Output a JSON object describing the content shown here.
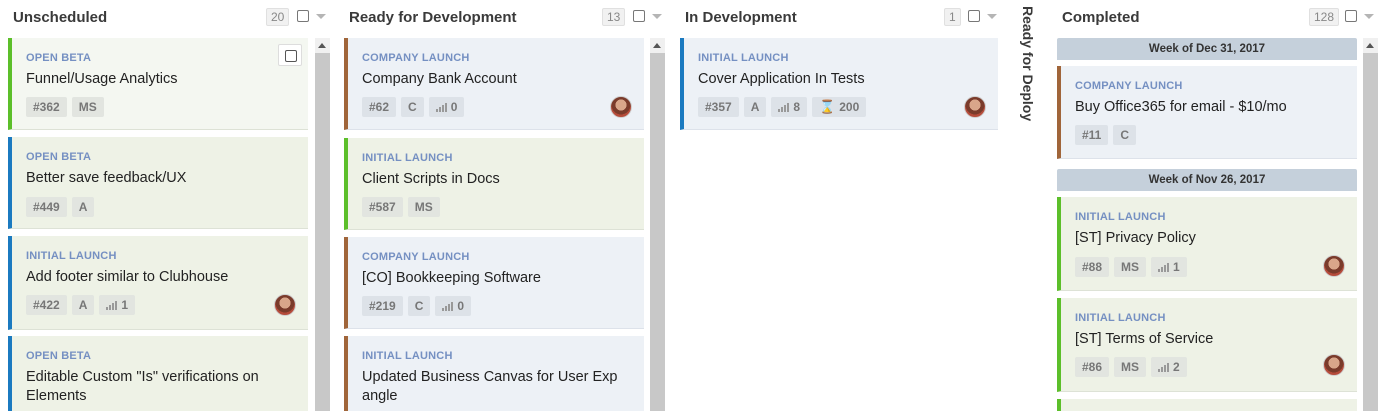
{
  "columns": [
    {
      "title": "Unscheduled",
      "count": "20",
      "cards": [
        {
          "epic": "OPEN BETA",
          "title": "Funnel/Usage Analytics",
          "badges": [
            "#362",
            "MS"
          ]
        },
        {
          "epic": "OPEN BETA",
          "title": "Better save feedback/UX",
          "badges": [
            "#449",
            "A"
          ]
        },
        {
          "epic": "INITIAL LAUNCH",
          "title": "Add footer similar to Clubhouse",
          "badges": [
            "#422",
            "A"
          ],
          "estimate": "1"
        },
        {
          "epic": "OPEN BETA",
          "title": "Editable Custom \"Is\" verifications on Elements",
          "badges": []
        }
      ]
    },
    {
      "title": "Ready for Development",
      "count": "13",
      "cards": [
        {
          "epic": "COMPANY LAUNCH",
          "title": "Company Bank Account",
          "badges": [
            "#62",
            "C"
          ],
          "estimate": "0"
        },
        {
          "epic": "INITIAL LAUNCH",
          "title": "Client Scripts in Docs",
          "badges": [
            "#587",
            "MS"
          ]
        },
        {
          "epic": "COMPANY LAUNCH",
          "title": "[CO] Bookkeeping Software",
          "badges": [
            "#219",
            "C"
          ],
          "estimate": "0"
        },
        {
          "epic": "INITIAL LAUNCH",
          "title": "Updated Business Canvas for User Exp angle",
          "badges": []
        }
      ]
    },
    {
      "title": "In Development",
      "count": "1",
      "cards": [
        {
          "epic": "INITIAL LAUNCH",
          "title": "Cover Application In Tests",
          "badges": [
            "#357",
            "A"
          ],
          "estimate": "8",
          "time": "200"
        }
      ]
    },
    {
      "title": "Ready for Deploy"
    },
    {
      "title": "Completed",
      "count": "128",
      "weeks": [
        "Week of Dec 31, 2017",
        "Week of Nov 26, 2017"
      ],
      "cards": [
        {
          "epic": "COMPANY LAUNCH",
          "title": "Buy Office365 for email - $10/mo",
          "badges": [
            "#11",
            "C"
          ]
        },
        {
          "epic": "INITIAL LAUNCH",
          "title": "[ST] Privacy Policy",
          "badges": [
            "#88",
            "MS"
          ],
          "estimate": "1"
        },
        {
          "epic": "INITIAL LAUNCH",
          "title": "[ST] Terms of Service",
          "badges": [
            "#86",
            "MS"
          ],
          "estimate": "2"
        }
      ]
    }
  ],
  "colors": {
    "green": "#5cbf2a",
    "blue": "#1b7ac0",
    "brown": "#a0653a",
    "epic_text": "#7590c2",
    "week_header": "#c5d0db"
  }
}
